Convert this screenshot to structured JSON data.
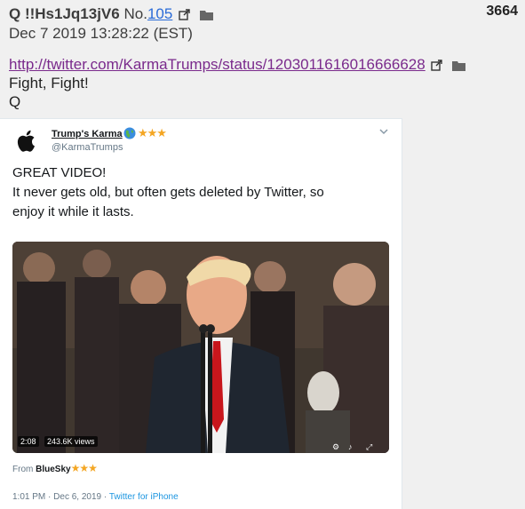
{
  "post": {
    "author": "Q !!Hs1Jq13jV6",
    "no_prefix": "No.",
    "no": "105",
    "id": "3664",
    "date": "Dec 7 2019 13:28:22 (EST)",
    "link": "http://twitter.com/KarmaTrumps/status/1203011616016666628",
    "lines": [
      "Fight, Fight!",
      "Q"
    ]
  },
  "tweet": {
    "name": "Trump's Karma",
    "handle": "@KarmaTrumps",
    "text": [
      "GREAT VIDEO!",
      "It never gets old, but often gets deleted by Twitter, so",
      "enjoy it while it lasts."
    ],
    "video": {
      "duration": "2:08",
      "views": "243.6K views"
    },
    "from_prefix": "From ",
    "from": "BlueSky",
    "time": "1:01 PM",
    "separator": "·",
    "date": "Dec 6, 2019",
    "via": "Twitter for iPhone"
  },
  "colors": {
    "star": "#f4a623",
    "link": "#7a2a8c",
    "accent": "#1b95e0"
  },
  "icons": [
    "external-link-icon",
    "folder-icon",
    "apple-logo",
    "globe-icon",
    "star-icon",
    "chevron-down-icon"
  ]
}
